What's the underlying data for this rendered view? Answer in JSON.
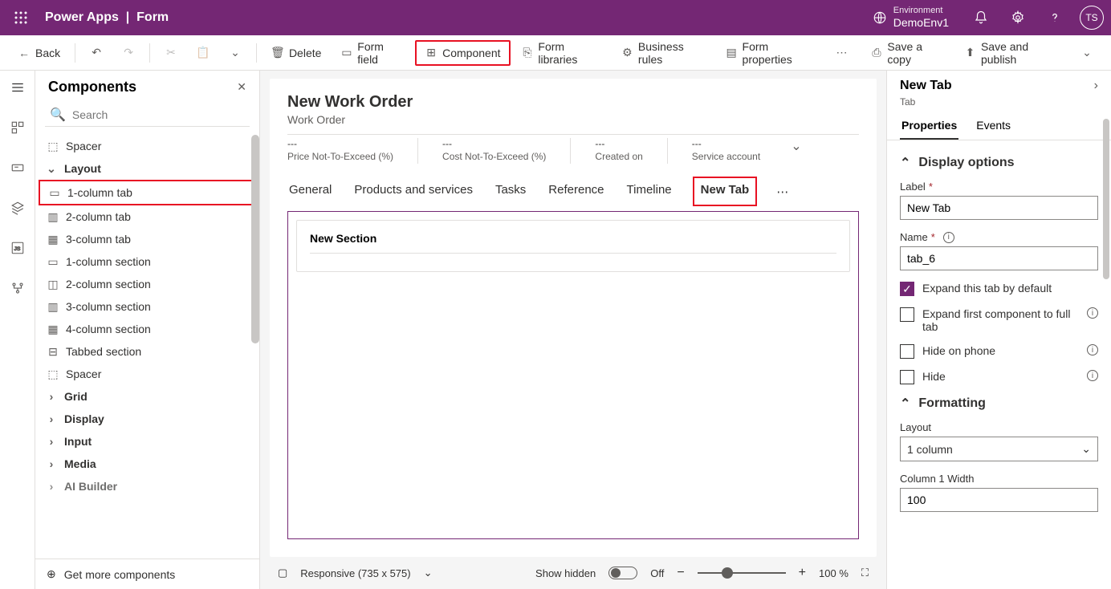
{
  "header": {
    "app": "Power Apps",
    "page": "Form",
    "env_label": "Environment",
    "env_name": "DemoEnv1",
    "avatar": "TS"
  },
  "cmd": {
    "back": "Back",
    "delete": "Delete",
    "form_field": "Form field",
    "component": "Component",
    "form_libraries": "Form libraries",
    "business_rules": "Business rules",
    "form_properties": "Form properties",
    "save_copy": "Save a copy",
    "save_publish": "Save and publish"
  },
  "components": {
    "title": "Components",
    "search_placeholder": "Search",
    "spacer": "Spacer",
    "layout": "Layout",
    "items": [
      "1-column tab",
      "2-column tab",
      "3-column tab",
      "1-column section",
      "2-column section",
      "3-column section",
      "4-column section",
      "Tabbed section",
      "Spacer"
    ],
    "groups": [
      "Grid",
      "Display",
      "Input",
      "Media",
      "AI Builder"
    ],
    "footer": "Get more components"
  },
  "form": {
    "title": "New Work Order",
    "entity": "Work Order",
    "header_fields": [
      {
        "value": "---",
        "label": "Price Not-To-Exceed (%)"
      },
      {
        "value": "---",
        "label": "Cost Not-To-Exceed (%)"
      },
      {
        "value": "---",
        "label": "Created on"
      },
      {
        "value": "---",
        "label": "Service account"
      }
    ],
    "tabs": [
      "General",
      "Products and services",
      "Tasks",
      "Reference",
      "Timeline",
      "New Tab"
    ],
    "section_title": "New Section"
  },
  "canvasFooter": {
    "responsive": "Responsive (735 x 575)",
    "show_hidden": "Show hidden",
    "off": "Off",
    "zoom": "100 %",
    "minus": "−",
    "plus": "+"
  },
  "props": {
    "title": "New Tab",
    "type": "Tab",
    "tabs": [
      "Properties",
      "Events"
    ],
    "display_options": "Display options",
    "label_lbl": "Label",
    "label_val": "New Tab",
    "name_lbl": "Name",
    "name_val": "tab_6",
    "expand_default": "Expand this tab by default",
    "expand_first": "Expand first component to full tab",
    "hide_phone": "Hide on phone",
    "hide": "Hide",
    "formatting": "Formatting",
    "layout_lbl": "Layout",
    "layout_val": "1 column",
    "col1_lbl": "Column 1 Width",
    "col1_val": "100"
  }
}
